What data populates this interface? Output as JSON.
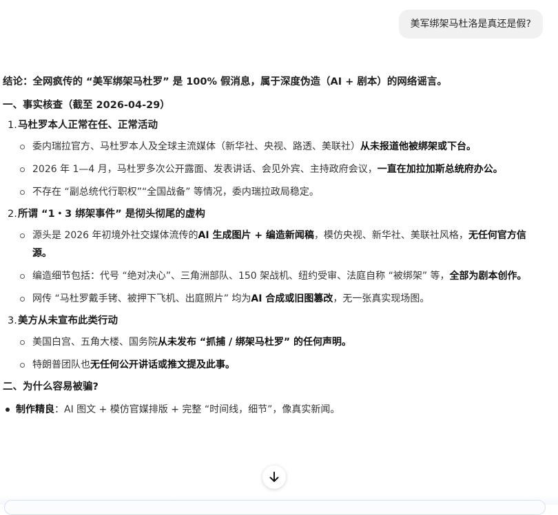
{
  "user_message": "美军绑架马杜洛是真还是假?",
  "conclusion": {
    "lead": "结论：",
    "body": "全网疯传的 “美军绑架马杜罗” 是 100% 假消息，属于深度伪造（AI + 剧本）的网络谣言。"
  },
  "section1": {
    "title": "一、事实核查（截至 2026-04-29）",
    "items": [
      {
        "num": "1.",
        "title": "马杜罗本人正常在任、正常活动",
        "subs": [
          {
            "plain": "委内瑞拉官方、马杜罗本人及全球主流媒体（新华社、央视、路透、美联社）",
            "bold": "从未报道他被绑架或下台。",
            "tail": ""
          },
          {
            "plain": "2026 年 1—4 月，马杜罗多次公开露面、发表讲话、会见外宾、主持政府会议，",
            "bold": "一直在加拉加斯总统府办公。",
            "tail": ""
          },
          {
            "plain": "不存在 “副总统代行职权”“全国战备” 等情况，委内瑞拉政局稳定。",
            "bold": "",
            "tail": ""
          }
        ]
      },
      {
        "num": "2.",
        "title": "所谓 “1・3 绑架事件” 是彻头彻尾的虚构",
        "subs": [
          {
            "plain": "源头是 2026 年初境外社交媒体流传的",
            "bold": "AI 生成图片 + 编造新闻稿",
            "tail": "，模仿央视、新华社、美联社风格，",
            "bold2": "无任何官方信源。"
          },
          {
            "plain": "编造细节包括：代号 “绝对决心”、三角洲部队、150 架战机、纽约受审、法庭自称 “被绑架” 等，",
            "bold": "全部为剧本创作。",
            "tail": ""
          },
          {
            "plain": "网传 “马杜罗戴手铐、被押下飞机、出庭照片” 均为",
            "bold": "AI 合成或旧图篡改",
            "tail": "，无一张真实现场图。"
          }
        ]
      },
      {
        "num": "3.",
        "title": "美方从未宣布此类行动",
        "subs": [
          {
            "plain": "美国白宫、五角大楼、国务院",
            "bold": "从未发布 “抓捕 / 绑架马杜罗” 的任何声明。",
            "tail": ""
          },
          {
            "plain": "特朗普团队也",
            "bold": "无任何公开讲话或推文提及此事。",
            "tail": ""
          }
        ]
      }
    ]
  },
  "section2": {
    "title": "二、为什么容易被骗?",
    "items": [
      {
        "bold": "制作精良",
        "plain": "：AI 图文 + 模仿官媒排版 + 完整 “时间线，细节”，像真实新闻。"
      }
    ]
  },
  "icons": {
    "scroll_down": "arrow-down-icon"
  }
}
